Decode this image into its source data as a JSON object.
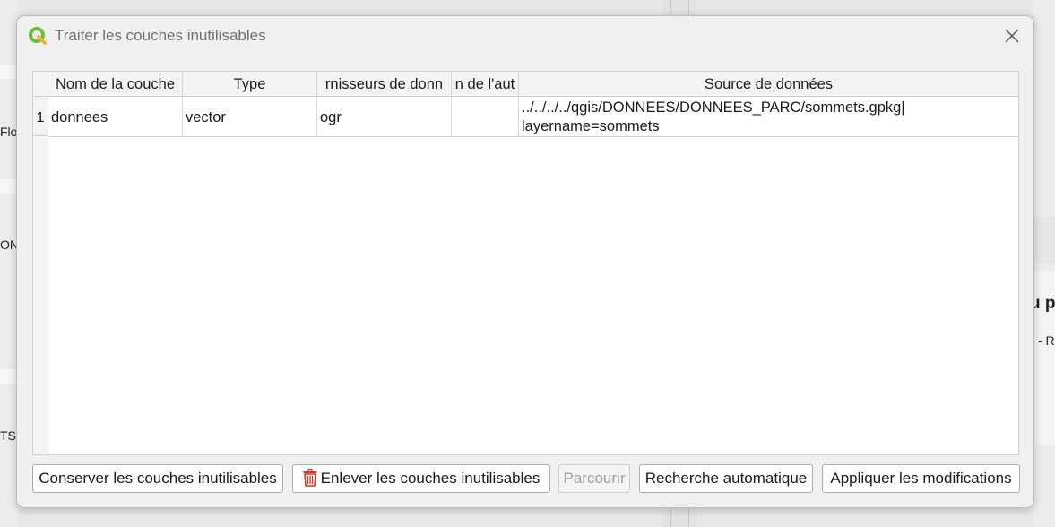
{
  "background": {
    "left_labels": [
      "Flo",
      "ON",
      "TS"
    ],
    "right_labels": [
      "u p",
      "- R"
    ]
  },
  "dialog": {
    "title": "Traiter les couches inutilisables",
    "icons": {
      "logo": "qgis-logo-icon",
      "close": "close-icon"
    }
  },
  "table": {
    "columns": [
      "Nom de la couche",
      "Type",
      "rnisseurs de donn",
      "n de l'aut",
      "Source de données"
    ],
    "rows": [
      {
        "index": "1",
        "name": "donnees",
        "type": "vector",
        "provider": "ogr",
        "auth": "",
        "source_line1": "../../../../qgis/DONNEES/DONNEES_PARC/sommets.gpkg|",
        "source_line2": "layername=sommets"
      }
    ]
  },
  "buttons": {
    "keep": "Conserver les couches inutilisables",
    "remove": "Enlever les couches inutilisables",
    "browse": "Parcourir",
    "auto_search": "Recherche automatique",
    "apply": "Appliquer les modifications",
    "remove_icon": "trash-icon"
  },
  "colors": {
    "qgis_green": "#6cbd45",
    "qgis_yellow": "#f0b431",
    "trash_red": "#d9342b"
  }
}
